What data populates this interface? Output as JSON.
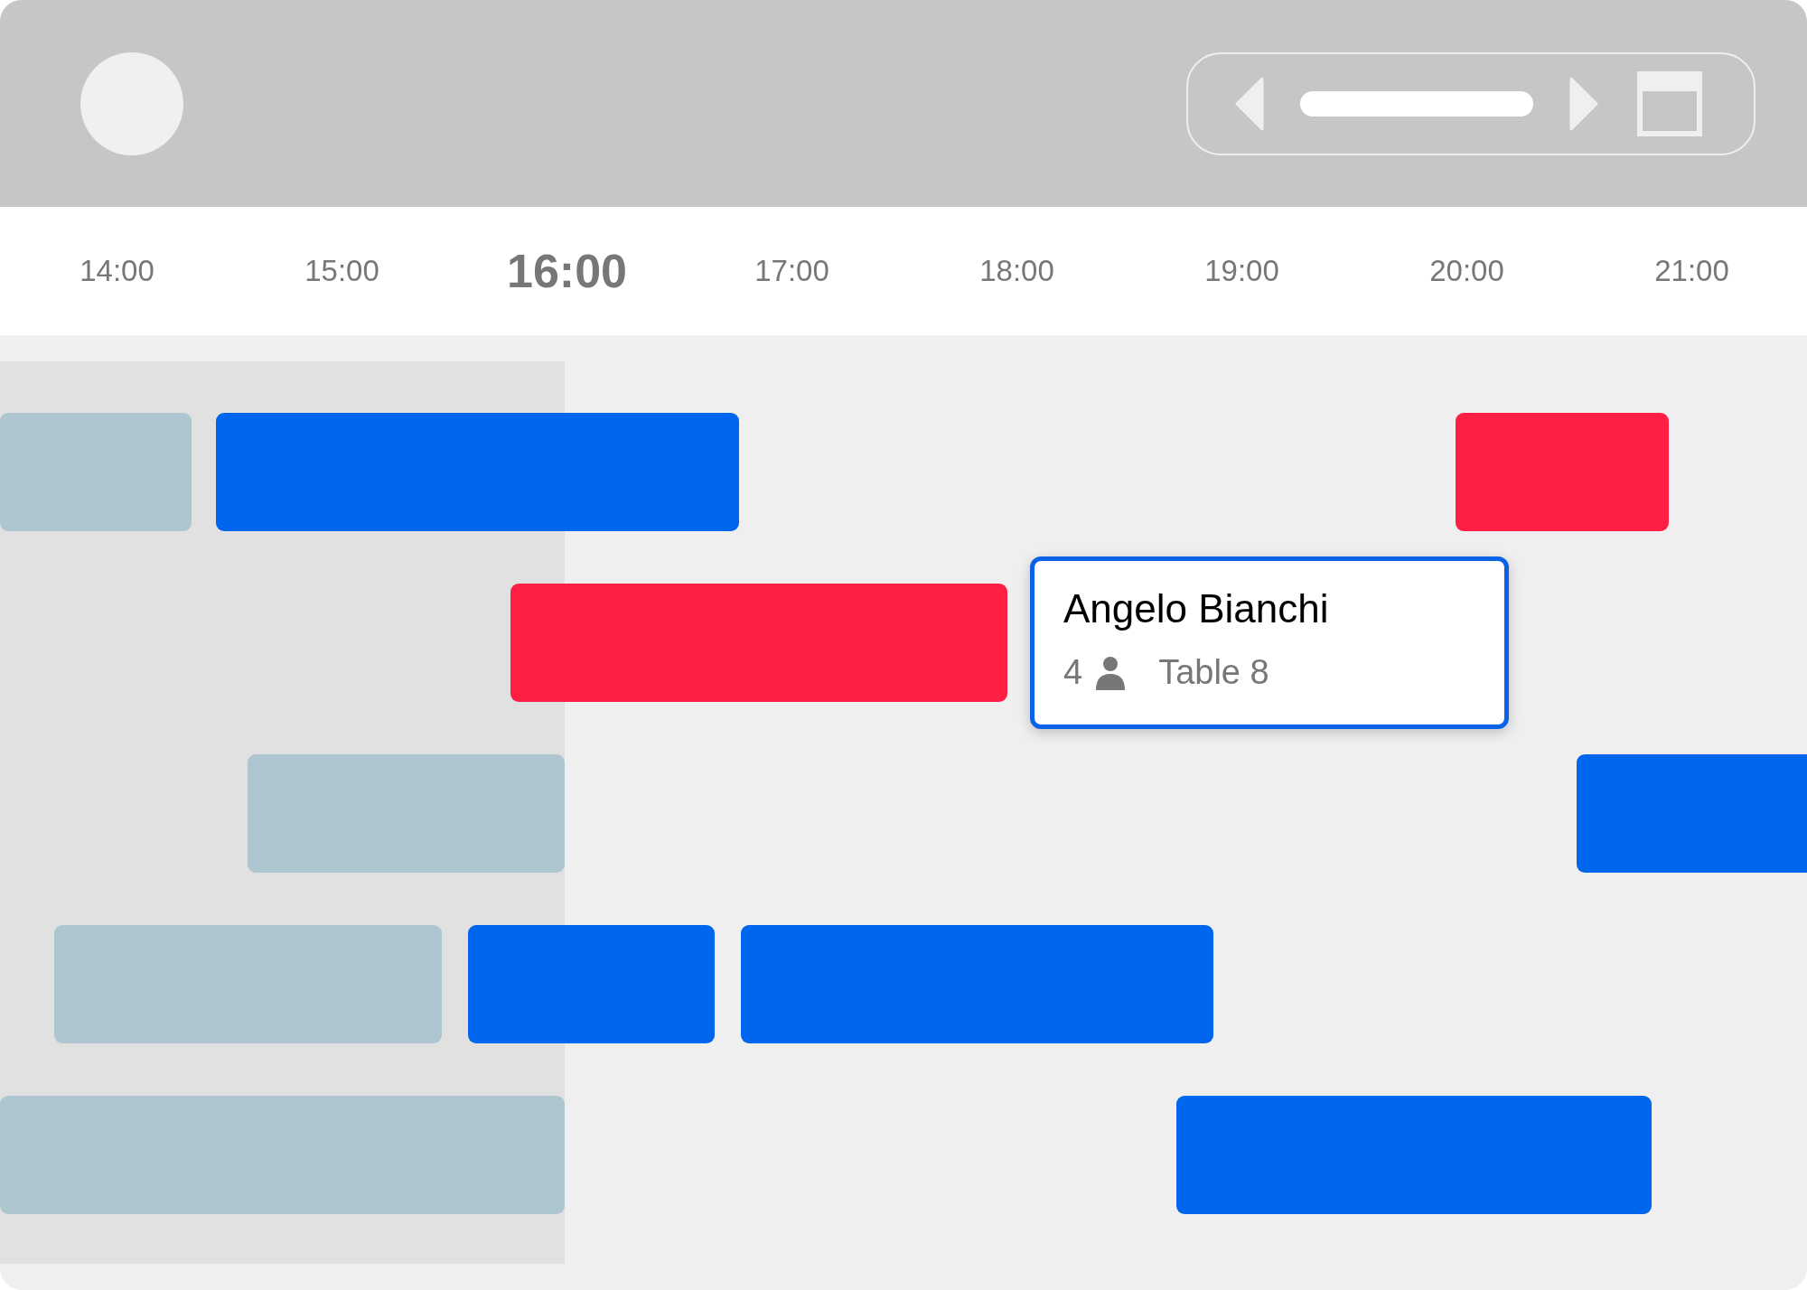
{
  "timeline": {
    "hours": [
      {
        "label": "14:00",
        "selected": false
      },
      {
        "label": "15:00",
        "selected": false
      },
      {
        "label": "16:00",
        "selected": true
      },
      {
        "label": "17:00",
        "selected": false
      },
      {
        "label": "18:00",
        "selected": false
      },
      {
        "label": "19:00",
        "selected": false
      },
      {
        "label": "20:00",
        "selected": false
      },
      {
        "label": "21:00",
        "selected": false
      }
    ]
  },
  "rows": [
    {
      "bookings": [
        {
          "color": "#adc6cf"
        },
        {
          "color": "#0066ee"
        },
        {
          "color": "#ff1f44"
        }
      ]
    },
    {
      "bookings": [
        {
          "color": "#ff1f44"
        }
      ]
    },
    {
      "bookings": [
        {
          "color": "#adc6cf"
        },
        {
          "color": "#0066ee"
        }
      ]
    },
    {
      "bookings": [
        {
          "color": "#adc6cf"
        },
        {
          "color": "#0066ee"
        },
        {
          "color": "#0066ee"
        }
      ]
    },
    {
      "bookings": [
        {
          "color": "#adc6cf"
        },
        {
          "color": "#0066ee"
        }
      ]
    }
  ],
  "tooltip": {
    "name": "Angelo Bianchi",
    "guests": "4",
    "table": "Table 8"
  }
}
